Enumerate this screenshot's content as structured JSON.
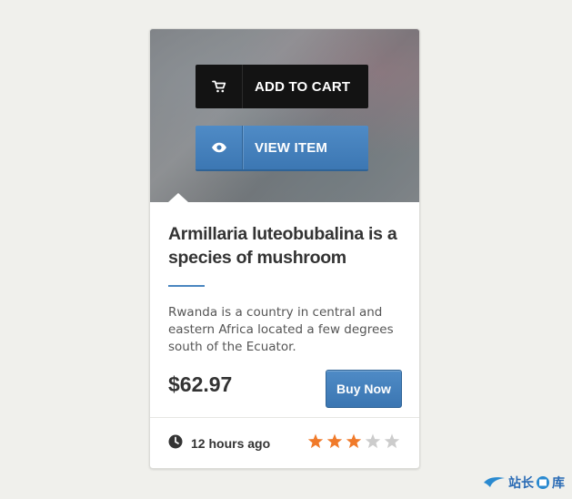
{
  "product": {
    "add_to_cart_label": "ADD TO CART",
    "view_item_label": "VIEW ITEM",
    "title": "Armillaria luteobubalina is a species of mushroom",
    "description": "Rwanda is a country in central and eastern Africa located a few degrees south of the Ecuator.",
    "price": "$62.97",
    "buy_label": "Buy Now",
    "posted": "12 hours ago",
    "rating": 3,
    "rating_max": 5
  },
  "colors": {
    "accent": "#4a86c0",
    "star_on": "#f07a2a",
    "star_off": "#cccccc"
  },
  "icons": [
    "cart-icon",
    "eye-icon",
    "clock-icon",
    "star-icon"
  ],
  "watermark": {
    "text": "站长",
    "text2": "库"
  }
}
